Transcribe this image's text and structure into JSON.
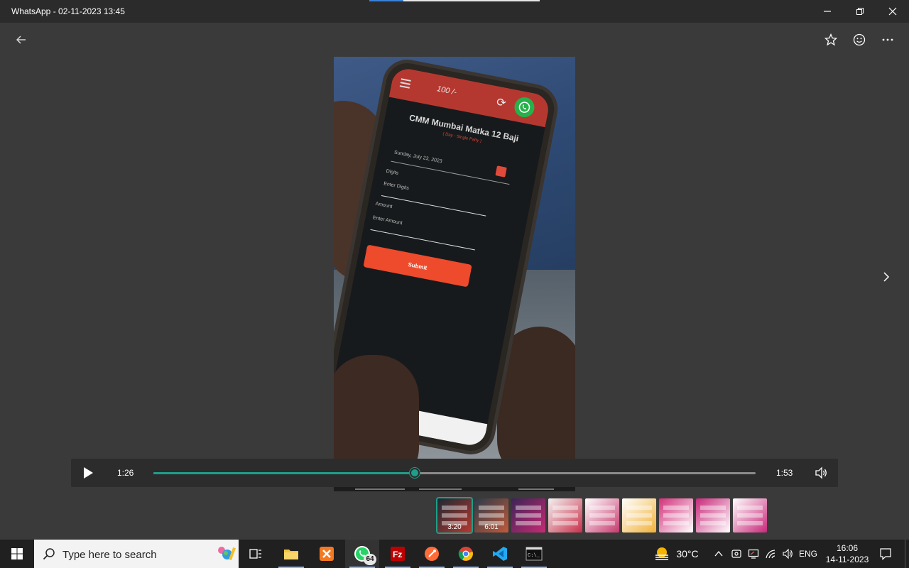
{
  "window": {
    "title": "WhatsApp - 02-11-2023 13:45"
  },
  "phone_app": {
    "wallet_text": "100 /-",
    "title": "CMM Mumbai Matka 12 Baji",
    "subtitle": "( Day - Single Patty )",
    "date_text": "Sunday, July 23, 2023",
    "digits_label": "Digits",
    "digits_placeholder": "Enter Digits",
    "amount_label": "Amount",
    "amount_placeholder": "Enter Amount",
    "submit_label": "Submit"
  },
  "player": {
    "current_time": "1:26",
    "duration": "1:53",
    "progress": 0.434
  },
  "thumbnails": [
    {
      "duration": "3:20",
      "colors": [
        "#1c2a34",
        "#b53830"
      ],
      "selected": true
    },
    {
      "duration": "6:01",
      "colors": [
        "#2c3b4a",
        "#c05a3a"
      ],
      "selected": false
    },
    {
      "duration": "",
      "colors": [
        "#3c2456",
        "#c62a74"
      ],
      "selected": false
    },
    {
      "duration": "",
      "colors": [
        "#f2f2f2",
        "#c9304a"
      ],
      "selected": false
    },
    {
      "duration": "",
      "colors": [
        "#ffffff",
        "#c63a6e"
      ],
      "selected": false
    },
    {
      "duration": "",
      "colors": [
        "#ffffff",
        "#f0b23a"
      ],
      "selected": false
    },
    {
      "duration": "",
      "colors": [
        "#d2317c",
        "#ffffff"
      ],
      "selected": false
    },
    {
      "duration": "",
      "colors": [
        "#c8287a",
        "#ffffff"
      ],
      "selected": false
    },
    {
      "duration": "",
      "colors": [
        "#ffffff",
        "#c8287a"
      ],
      "selected": false
    }
  ],
  "taskbar": {
    "search_placeholder": "Type here to search",
    "whatsapp_badge": "64",
    "temperature": "30°C",
    "language": "ENG",
    "time": "16:06",
    "date": "14-11-2023"
  },
  "colors": {
    "accent": "#1f9e8a",
    "app_bg": "#3a3a3a",
    "titlebar": "#2b2b2b",
    "taskbar": "#202020",
    "submit_red": "#ee4a2c"
  }
}
